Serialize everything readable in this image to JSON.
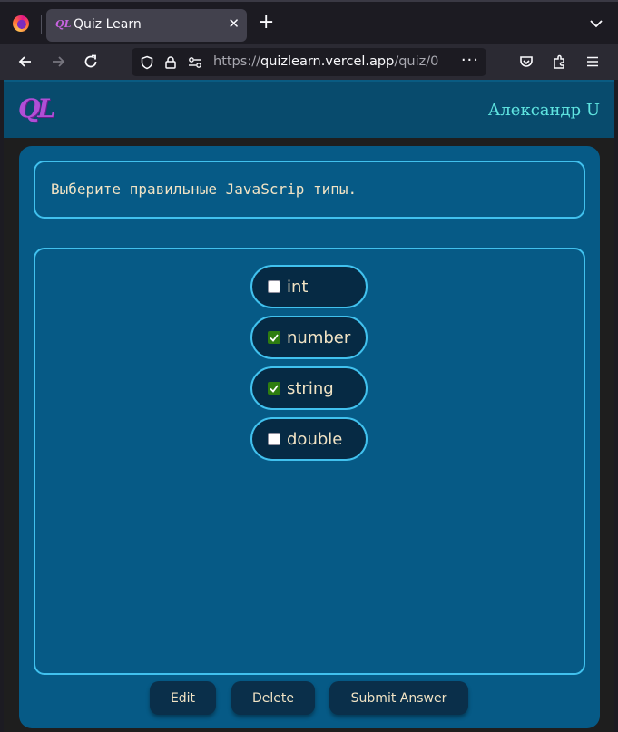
{
  "browser": {
    "tab_title": "Quiz Learn",
    "tab_icon_text": "QL",
    "url_scheme": "https://",
    "url_host": "quizlearn.vercel.app",
    "url_path": "/quiz/0",
    "icons": [
      "firefox-icon",
      "close-icon",
      "plus-icon",
      "chevron-down-icon",
      "back-icon",
      "forward-icon",
      "reload-icon",
      "shield-icon",
      "lock-icon",
      "permissions-icon",
      "more-icon",
      "pocket-icon",
      "extensions-icon",
      "menu-icon"
    ]
  },
  "header": {
    "logo_text": "QL",
    "user_name": "Александр U"
  },
  "quiz": {
    "question": "Выберите правильные JavaScrip типы.",
    "answers": [
      {
        "label": "int",
        "checked": false
      },
      {
        "label": "number",
        "checked": true
      },
      {
        "label": "string",
        "checked": true
      },
      {
        "label": "double",
        "checked": false
      }
    ]
  },
  "actions": {
    "edit_label": "Edit",
    "delete_label": "Delete",
    "submit_label": "Submit Answer"
  },
  "colors": {
    "header_bg": "#084b6d",
    "card_bg": "#065a86",
    "border_accent": "#41c1ee",
    "answer_bg": "#062a44",
    "text_cream": "#f1e3c4",
    "user_name": "#5fe4e0",
    "logo": "#b04ed6"
  }
}
